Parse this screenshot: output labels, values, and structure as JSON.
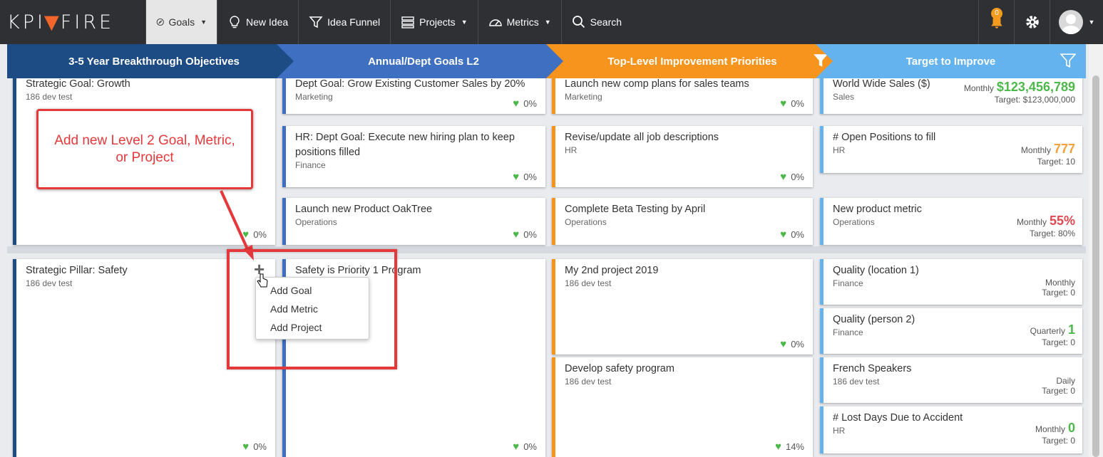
{
  "nav": {
    "logo_left": "KPI",
    "logo_right": "FIRE",
    "items": [
      {
        "label": "Goals",
        "icon": "compass-icon",
        "caret": true
      },
      {
        "label": "New Idea",
        "icon": "lightbulb-icon"
      },
      {
        "label": "Idea Funnel",
        "icon": "funnel-icon"
      },
      {
        "label": "Projects",
        "icon": "list-icon",
        "caret": true
      },
      {
        "label": "Metrics",
        "icon": "gauge-icon",
        "caret": true
      },
      {
        "label": "Search",
        "icon": "search-icon"
      }
    ],
    "notifications": "0"
  },
  "headers": [
    "3-5 Year Breakthrough Objectives",
    "Annual/Dept Goals L2",
    "Top-Level Improvement Priorities",
    "Target to Improve"
  ],
  "colors": {
    "col1": "#1d4b84",
    "col2": "#3f6fc1",
    "col3": "#f7941d",
    "col4": "#64b3ee",
    "callout": "#e5383b"
  },
  "col1": [
    {
      "title": "Strategic Goal: Growth",
      "sub": "186 dev test",
      "pct": "0%"
    },
    {
      "title": "Strategic Pillar: Safety",
      "sub": "186 dev test",
      "pct": "0%"
    }
  ],
  "col2": [
    {
      "title": "Dept Goal: Grow Existing Customer Sales by 20%",
      "sub": "Marketing",
      "pct": "0%"
    },
    {
      "title": "HR: Dept Goal: Execute new hiring plan to keep positions filled",
      "sub": "Finance",
      "pct": "0%"
    },
    {
      "title": "Launch new Product OakTree",
      "sub": "Operations",
      "pct": "0%"
    },
    {
      "title": "Safety is Priority 1 Program",
      "sub": "",
      "pct": "0%"
    }
  ],
  "col3": [
    {
      "title": "Launch new comp plans for sales teams",
      "sub": "Marketing",
      "pct": "0%"
    },
    {
      "title": "Revise/update all job descriptions",
      "sub": "HR",
      "pct": "0%"
    },
    {
      "title": "Complete Beta Testing by April",
      "sub": "Operations",
      "pct": "0%"
    },
    {
      "title": "My 2nd project 2019",
      "sub": "186 dev test",
      "pct": "0%"
    },
    {
      "title": "Develop safety program",
      "sub": "186 dev test",
      "pct": "14%"
    }
  ],
  "col4": [
    {
      "title": "World Wide Sales ($)",
      "sub": "Sales",
      "freq": "Monthly",
      "value": "$123,456,789",
      "target": "Target: $123,000,000"
    },
    {
      "title": "# Open Positions to fill",
      "sub": "HR",
      "freq": "Monthly",
      "value": "777",
      "target": "Target: 10"
    },
    {
      "title": "New product metric",
      "sub": "Operations",
      "freq": "Monthly",
      "value": "55%",
      "target": "Target: 80%"
    },
    {
      "title": "Quality (location 1)",
      "sub": "Finance",
      "freq": "Monthly",
      "value": "",
      "target": "Target: 0"
    },
    {
      "title": "Quality (person 2)",
      "sub": "Finance",
      "freq": "Quarterly",
      "value": "1",
      "target": "Target: 0"
    },
    {
      "title": "French Speakers",
      "sub": "186 dev test",
      "freq": "Daily",
      "value": "",
      "target": "Target: 0"
    },
    {
      "title": "# Lost Days Due to Accident",
      "sub": "HR",
      "freq": "Monthly",
      "value": "0",
      "target": "Target: 0"
    }
  ],
  "callout": {
    "line1": "Add new Level 2 Goal, Metric,",
    "line2": "or Project"
  },
  "menu": [
    "Add Goal",
    "Add Metric",
    "Add Project"
  ],
  "plus": "+"
}
